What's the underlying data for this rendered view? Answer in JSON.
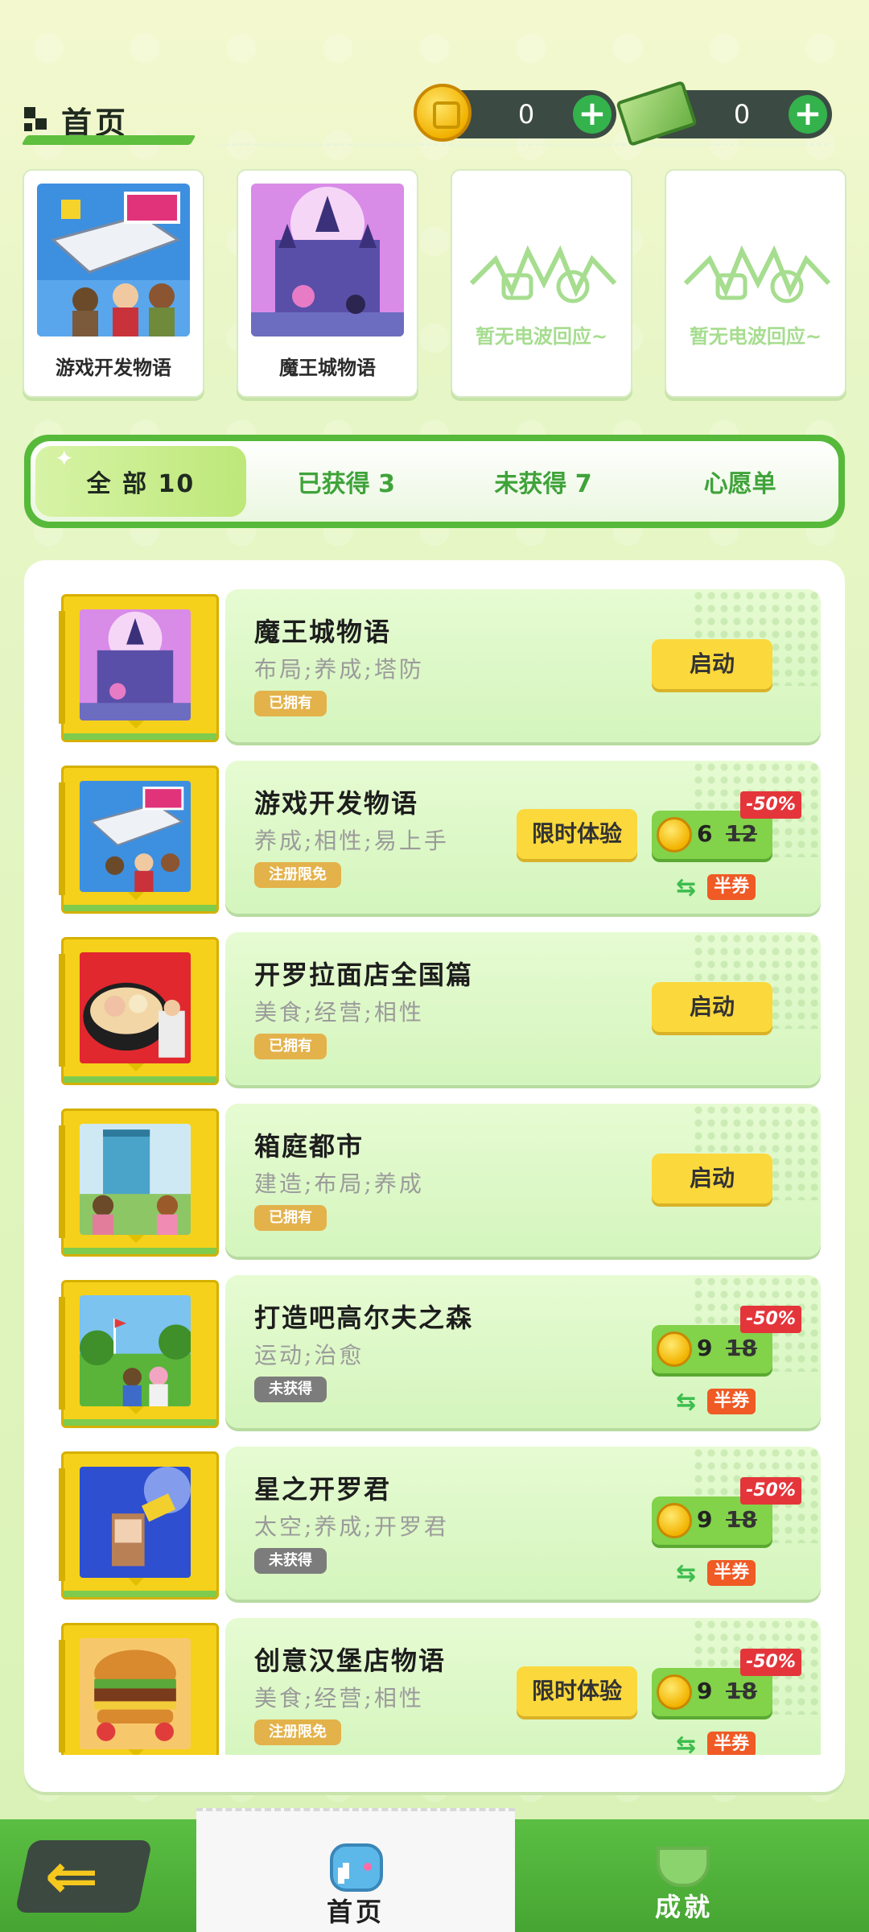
{
  "header": {
    "title": "首页",
    "coins": "0",
    "cash": "0",
    "add_label": "+"
  },
  "recent": [
    {
      "name": "游戏开发物语",
      "art": "console-icon"
    },
    {
      "name": "魔王城物语",
      "art": "castle-icon"
    },
    {
      "empty_text": "暂无电波回应~"
    },
    {
      "empty_text": "暂无电波回应~"
    }
  ],
  "tabs": {
    "all": "全 部 10",
    "owned": "已获得 3",
    "unowned": "未获得 7",
    "wishlist": "心愿单"
  },
  "games": [
    {
      "name": "魔王城物语",
      "tags": "布局;养成;塔防",
      "badge": "已拥有",
      "action": "启动",
      "art": "castle-icon"
    },
    {
      "name": "游戏开发物语",
      "tags": "养成;相性;易上手",
      "badge": "注册限免",
      "trial": "限时体验",
      "price_now": "6",
      "price_old": "12",
      "discount": "-50%",
      "half": "半券",
      "art": "console-icon"
    },
    {
      "name": "开罗拉面店全国篇",
      "tags": "美食;经营;相性",
      "badge": "已拥有",
      "action": "启动",
      "art": "ramen-icon"
    },
    {
      "name": "箱庭都市",
      "tags": "建造;布局;养成",
      "badge": "已拥有",
      "action": "启动",
      "art": "city-icon"
    },
    {
      "name": "打造吧高尔夫之森",
      "tags": "运动;治愈",
      "badge": "未获得",
      "price_now": "9",
      "price_old": "18",
      "discount": "-50%",
      "half": "半券",
      "art": "golf-icon"
    },
    {
      "name": "星之开罗君",
      "tags": "太空;养成;开罗君",
      "badge": "未获得",
      "price_now": "9",
      "price_old": "18",
      "discount": "-50%",
      "half": "半券",
      "art": "space-icon"
    },
    {
      "name": "创意汉堡店物语",
      "tags": "美食;经营;相性",
      "badge": "注册限免",
      "trial": "限时体验",
      "price_now": "9",
      "price_old": "18",
      "discount": "-50%",
      "half": "半券",
      "art": "burger-icon"
    }
  ],
  "nav": {
    "back_icon": "back-arrow-icon",
    "home": "首页",
    "achievements": "成就"
  },
  "colors": {
    "accent_green": "#56b93a",
    "button_yellow": "#fbd83c",
    "discount_red": "#e4353b"
  }
}
